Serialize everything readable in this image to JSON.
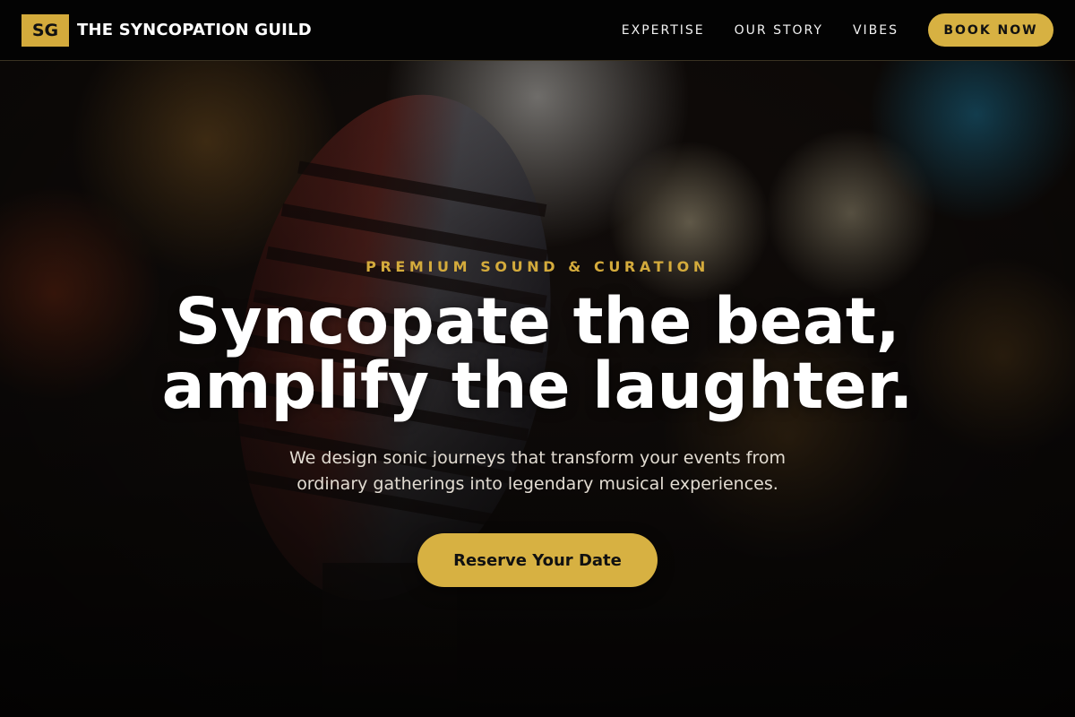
{
  "brand": {
    "mark": "SG",
    "name": "THE SYNCOPATION GUILD"
  },
  "nav": {
    "links": [
      "EXPERTISE",
      "OUR STORY",
      "VIBES"
    ],
    "cta": "BOOK NOW"
  },
  "hero": {
    "eyebrow": "PREMIUM SOUND & CURATION",
    "headline_line1": "Syncopate the beat,",
    "headline_line2": "amplify the laughter.",
    "subtext_line1": "We design sonic journeys that transform your events from",
    "subtext_line2": "ordinary gatherings into legendary musical experiences.",
    "cta": "Reserve Your Date",
    "background_image": "vintage-microphone-bokeh-photo"
  },
  "colors": {
    "accent": "#d7b142",
    "nav_bg": "#030303",
    "text": "#ffffff"
  }
}
